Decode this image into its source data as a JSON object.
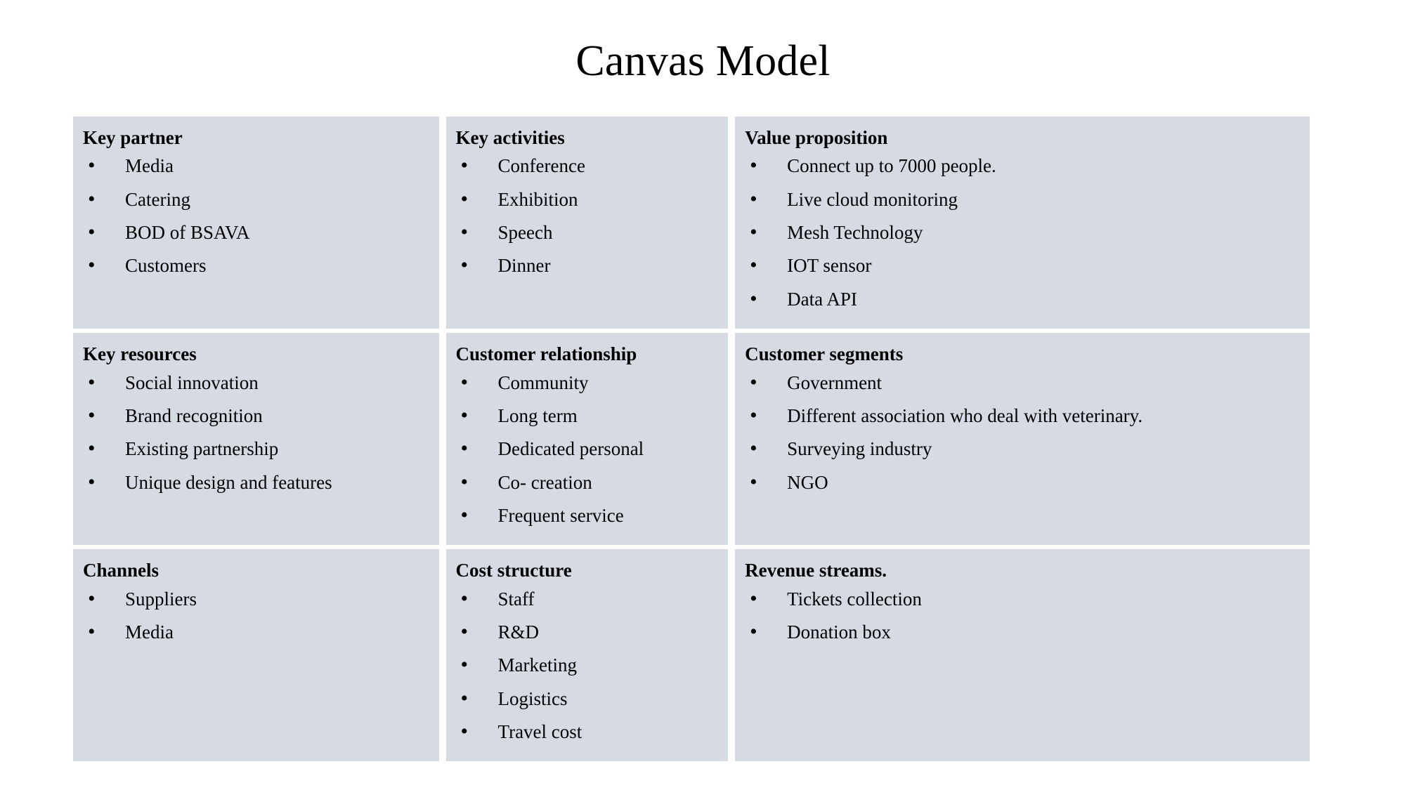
{
  "document": {
    "title": "Canvas Model",
    "background_color": "#ffffff",
    "cell_background_color": "#d6dae3",
    "text_color": "#000000"
  },
  "canvas": {
    "blocks": [
      {
        "id": "key-partner",
        "title": "Key partner",
        "items": [
          "Media",
          "Catering",
          "BOD of BSAVA",
          "Customers"
        ]
      },
      {
        "id": "key-activities",
        "title": "Key activities",
        "items": [
          "Conference",
          "Exhibition",
          "Speech",
          "Dinner"
        ]
      },
      {
        "id": "value-proposition",
        "title": "Value proposition",
        "items": [
          "Connect up to 7000 people.",
          "Live cloud monitoring",
          "Mesh Technology",
          "IOT sensor",
          "Data API"
        ]
      },
      {
        "id": "key-resources",
        "title": "Key resources",
        "items": [
          "Social innovation",
          "Brand recognition",
          "Existing partnership",
          "Unique design and features"
        ]
      },
      {
        "id": "customer-relationship",
        "title": "Customer relationship",
        "items": [
          "Community",
          "Long term",
          "Dedicated personal",
          "Co- creation",
          "Frequent service"
        ]
      },
      {
        "id": "customer-segments",
        "title": "Customer segments",
        "items": [
          "Government",
          "Different association who deal with veterinary.",
          "Surveying industry",
          "NGO"
        ]
      },
      {
        "id": "channels",
        "title": "Channels",
        "items": [
          "Suppliers",
          "Media"
        ]
      },
      {
        "id": "cost-structure",
        "title": "Cost structure",
        "items": [
          "Staff",
          "R&D",
          "Marketing",
          "Logistics",
          "Travel cost"
        ]
      },
      {
        "id": "revenue-streams",
        "title": "Revenue streams.",
        "items": [
          "Tickets collection",
          "Donation box"
        ]
      }
    ]
  }
}
